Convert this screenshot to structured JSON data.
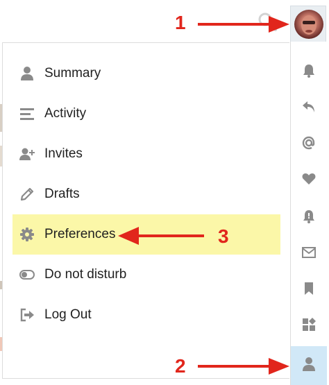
{
  "menu": {
    "items": [
      {
        "label": "Summary",
        "icon": "user-icon"
      },
      {
        "label": "Activity",
        "icon": "stream-icon"
      },
      {
        "label": "Invites",
        "icon": "user-plus-icon"
      },
      {
        "label": "Drafts",
        "icon": "pencil-icon"
      },
      {
        "label": "Preferences",
        "icon": "gear-icon",
        "highlighted": true
      },
      {
        "label": "Do not disturb",
        "icon": "toggle-off-icon"
      },
      {
        "label": "Log Out",
        "icon": "sign-out-icon"
      }
    ]
  },
  "rail": {
    "items": [
      {
        "icon": "bell-icon"
      },
      {
        "icon": "reply-icon"
      },
      {
        "icon": "at-icon"
      },
      {
        "icon": "heart-icon"
      },
      {
        "icon": "bell-alert-icon"
      },
      {
        "icon": "envelope-icon"
      },
      {
        "icon": "bookmark-icon"
      },
      {
        "icon": "shapes-icon"
      },
      {
        "icon": "user-icon",
        "active": true
      }
    ]
  },
  "annotations": {
    "label_1": "1",
    "label_2": "2",
    "label_3": "3"
  },
  "colors": {
    "annotation_red": "#e1261c",
    "highlight_yellow": "#fbf7a8",
    "active_tab_blue": "#d1e8f7",
    "icon_gray": "#8a8a8a"
  }
}
